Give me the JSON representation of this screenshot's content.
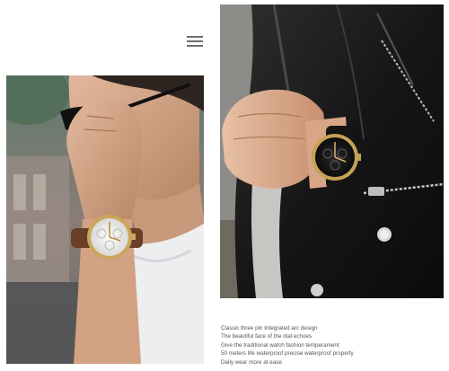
{
  "header": {
    "menu_icon": "hamburger-menu-icon"
  },
  "images": {
    "left": {
      "subject": "man in sunglasses and white t-shirt wearing a gold watch with white dial"
    },
    "right": {
      "subject": "wrist in black leather jacket wearing a gold watch with black dial"
    }
  },
  "caption": {
    "lines": [
      "Classic three pin Integrated arc design",
      "The beautiful face of the dial echoes",
      "Give the traditional watch fashion temperament",
      "50 meters life waterproof precise waterproof property",
      "Daily wear more at ease"
    ]
  },
  "colors": {
    "text": "#555555",
    "icon": "#6f6f6f",
    "background": "#ffffff"
  }
}
